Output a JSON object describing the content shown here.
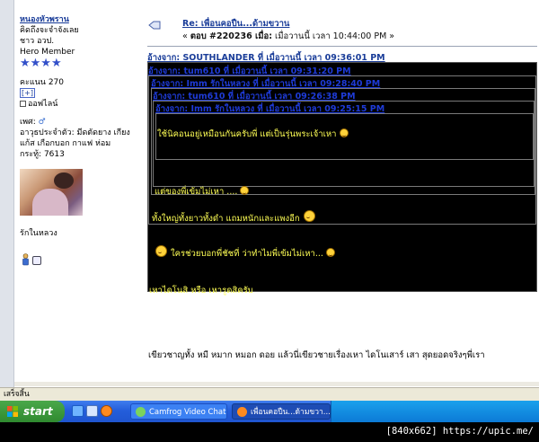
{
  "sidebar": {
    "username": "หนองหัวพราน",
    "tagline": "คิดถึงจะจำจังเลย",
    "group": "ชาว อวป.",
    "rank": "Hero Member",
    "stars": "★★★★",
    "karma": "คะแนน 270",
    "karma_plus": "[+]",
    "status": "ออฟไลน์",
    "gender_label": "เพศ:",
    "gender_symbol": "♂",
    "hobby": "อาวุธประจำตัว: มีดตัดยาง เกียงแก้ส เกือกบอก กาแฟ ห่อม",
    "posts": "กระทู้: 7613",
    "signature": "รักในหลวง"
  },
  "post": {
    "title": "Re: เพื่อนคอปืน...ด้ามขวาน",
    "meta_prefix": "« ",
    "reply_label": "ตอบ #220236 เมื่อ:",
    "time_text": " เมื่อวานนี้ เวลา 10:44:00 PM »"
  },
  "quotes": {
    "q1": "อ้างจาก: SOUTHLANDER ที่ เมื่อวานนี้ เวลา 09:36:01 PM",
    "q2": "อ้างจาก: tum610 ที่ เมื่อวานนี้ เวลา 09:31:20 PM",
    "q3": "อ้างจาก: Imm รักในหลวง ที่ เมื่อวานนี้ เวลา 09:28:40 PM",
    "q4": "อ้างจาก: tum610 ที่ เมื่อวานนี้ เวลา 09:26:38 PM",
    "q5": "อ้างจาก: Imm รักในหลวง ที่ เมื่อวานนี้ เวลา 09:25:15 PM",
    "t5": "ใช้นิคอนอยู่เหมือนกันครับพี่ แต่เป็นรุ่นพระเจ้าเหา",
    "t4": "แต่ของพี่เข้มไม่เหา ....",
    "t3": "ทั้งใหญ่ทั้งยาวทั้งดำ แถมหนักและแพงอีก",
    "t2": "ใครช่วยบอกพี่ชัชที่  ว่าทำไมพี่เข้มไม่เหา...",
    "t1": "เหาไดโนสิ หรือ เหารูดสิครับ"
  },
  "body_text": "เขียวชาญทั้ง หมี หมาก หมอก ดอย  แล้วนี่เขียวชายเรื่องเหา ไดโนเสาร์ เสา     สุดยอดจริงๆพี่เรา",
  "statusbar": {
    "text": "เสร็จสิ้น"
  },
  "taskbar": {
    "start_label": "start",
    "task1_label": "Camfrog Video Chat",
    "task2_label": "เพื่อนคอปืน...ด้ามขวา..."
  },
  "caption": "[840x662] https://upic.me/",
  "colors": {
    "link": "#1a3d99",
    "quote_bg": "#000000",
    "quote_text": "#ffff55",
    "taskbar": "#245edb",
    "start_button": "#2f8a2f"
  },
  "icons": [
    "post-icon",
    "offline-icon",
    "gender-male-icon",
    "profile-icon",
    "message-icon",
    "smiley-icon",
    "windows-flag-icon",
    "ie-icon",
    "desktop-icon",
    "firefox-icon",
    "camfrog-icon"
  ]
}
